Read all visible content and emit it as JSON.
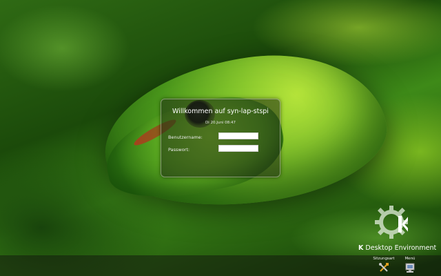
{
  "login": {
    "title": "Willkommen auf syn-lap-stspi",
    "datetime": "Di 20.Juni 08:47",
    "username_label": "Benutzername:",
    "username_value": "",
    "password_label": "Passwort:",
    "password_value": ""
  },
  "branding": {
    "k_letter": "K",
    "rest": "Desktop Environment"
  },
  "bottom_bar": {
    "session_label": "Sitzungsart",
    "session_icon": "tools-icon",
    "menu_label": "Menü",
    "menu_icon": "computer-icon"
  },
  "colors": {
    "panel_border": "#c8d2be",
    "input_bg": "#ffffff",
    "text": "#ffffff"
  }
}
